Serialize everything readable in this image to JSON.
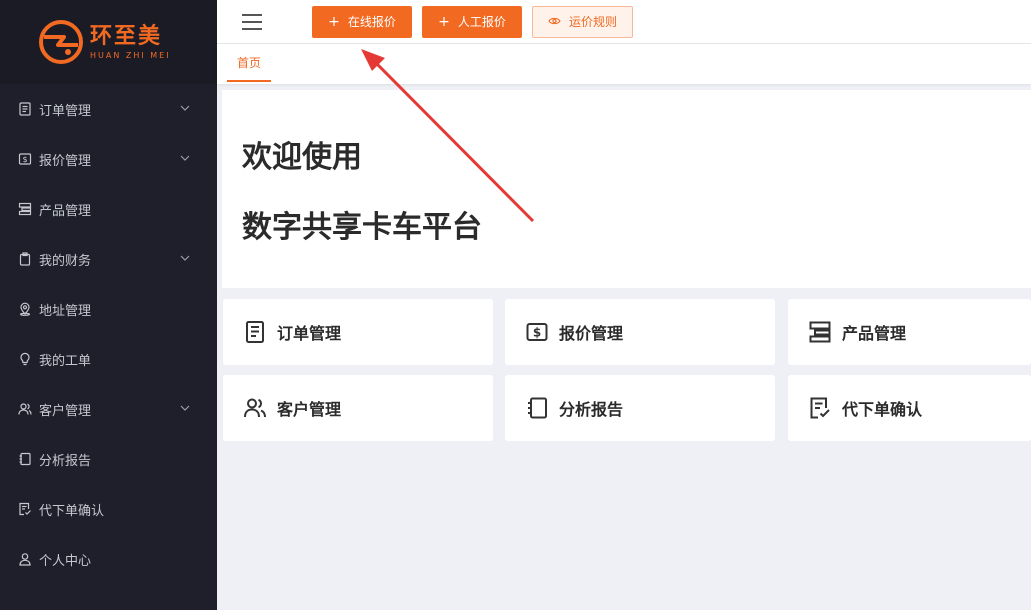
{
  "app": {
    "logo_cn": "环至美",
    "logo_en": "HUAN ZHI MEI"
  },
  "colors": {
    "accent": "#f26a22",
    "sidebar_bg": "#1f1f2b",
    "annotation_arrow": "#e53935"
  },
  "sidebar": {
    "items": [
      {
        "label": "订单管理",
        "icon": "order-doc-icon",
        "has_children": true
      },
      {
        "label": "报价管理",
        "icon": "dollar-icon",
        "has_children": true
      },
      {
        "label": "产品管理",
        "icon": "product-icon",
        "has_children": false
      },
      {
        "label": "我的财务",
        "icon": "clipboard-icon",
        "has_children": true
      },
      {
        "label": "地址管理",
        "icon": "location-icon",
        "has_children": false
      },
      {
        "label": "我的工单",
        "icon": "bulb-icon",
        "has_children": false
      },
      {
        "label": "客户管理",
        "icon": "users-icon",
        "has_children": true
      },
      {
        "label": "分析报告",
        "icon": "notebook-icon",
        "has_children": false
      },
      {
        "label": "代下单确认",
        "icon": "doc-check-icon",
        "has_children": false
      },
      {
        "label": "个人中心",
        "icon": "user-icon",
        "has_children": false
      }
    ]
  },
  "toolbar": {
    "online_quote": "在线报价",
    "manual_quote": "人工报价",
    "freight_rules": "运价规则"
  },
  "tabs": {
    "home": "首页"
  },
  "welcome": {
    "line1": "欢迎使用",
    "line2": "数字共享卡车平台"
  },
  "cards": [
    {
      "label": "订单管理",
      "icon": "order-doc-icon"
    },
    {
      "label": "报价管理",
      "icon": "dollar-icon"
    },
    {
      "label": "产品管理",
      "icon": "product-icon"
    },
    {
      "label": "客户管理",
      "icon": "users-icon"
    },
    {
      "label": "分析报告",
      "icon": "notebook-icon"
    },
    {
      "label": "代下单确认",
      "icon": "doc-check-icon"
    }
  ]
}
